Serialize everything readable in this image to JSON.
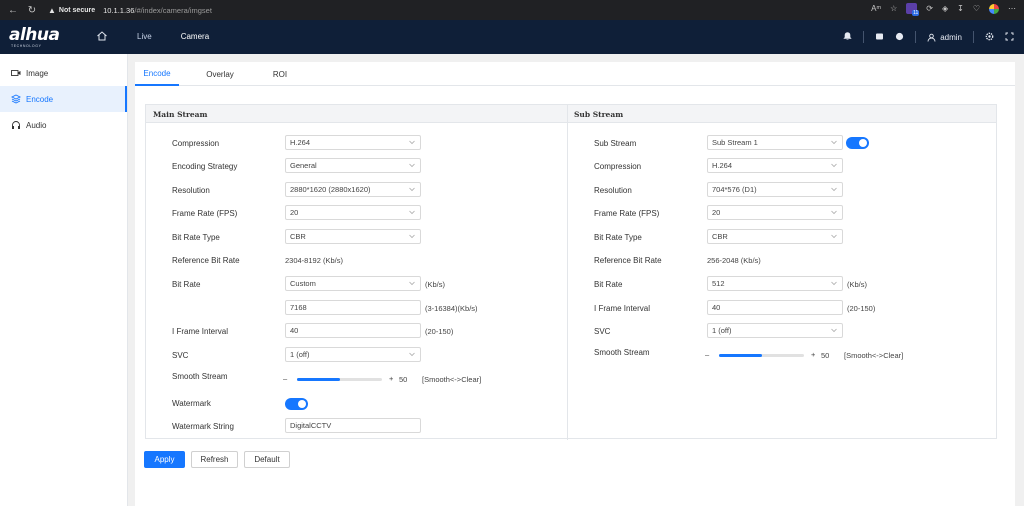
{
  "browser": {
    "not_secure": "Not secure",
    "url_host": "10.1.1.36",
    "url_path": "/#/index/camera/imgset",
    "ext_badge": "11"
  },
  "header": {
    "logo_text": "alhua",
    "logo_sub": "TECHNOLOGY",
    "nav": {
      "live": "Live",
      "camera": "Camera"
    },
    "user": "admin"
  },
  "sidebar": {
    "items": [
      {
        "label": "Image"
      },
      {
        "label": "Encode"
      },
      {
        "label": "Audio"
      }
    ]
  },
  "tabs": [
    "Encode",
    "Overlay",
    "ROI"
  ],
  "main_stream": {
    "title": "Main Stream",
    "compression_label": "Compression",
    "compression": "H.264",
    "encoding_label": "Encoding Strategy",
    "encoding": "General",
    "resolution_label": "Resolution",
    "resolution": "2880*1620 (2880x1620)",
    "fps_label": "Frame Rate (FPS)",
    "fps": "20",
    "brt_label": "Bit Rate Type",
    "brt": "CBR",
    "ref_label": "Reference Bit Rate",
    "ref": "2304-8192 (Kb/s)",
    "bitrate_label": "Bit Rate",
    "bitrate": "Custom",
    "bitrate_unit": "(Kb/s)",
    "custom_value": "7168",
    "custom_range": "(3-16384)(Kb/s)",
    "iframe_label": "I Frame Interval",
    "iframe": "40",
    "iframe_range": "(20-150)",
    "svc_label": "SVC",
    "svc": "1 (off)",
    "smooth_label": "Smooth Stream",
    "smooth_minus": "–",
    "smooth_plus": "+",
    "smooth_value": "50",
    "smooth_hint": "[Smooth<->Clear]",
    "smooth_level": 0.5,
    "watermark_label": "Watermark",
    "watermark_on": true,
    "watermark_string_label": "Watermark String",
    "watermark_string": "DigitalCCTV"
  },
  "sub_stream": {
    "title": "Sub Stream",
    "sub_label": "Sub Stream",
    "sub": "Sub Stream 1",
    "sub_on": true,
    "compression_label": "Compression",
    "compression": "H.264",
    "resolution_label": "Resolution",
    "resolution": "704*576 (D1)",
    "fps_label": "Frame Rate (FPS)",
    "fps": "20",
    "brt_label": "Bit Rate Type",
    "brt": "CBR",
    "ref_label": "Reference Bit Rate",
    "ref": "256-2048 (Kb/s)",
    "bitrate_label": "Bit Rate",
    "bitrate": "512",
    "bitrate_unit": "(Kb/s)",
    "iframe_label": "I Frame Interval",
    "iframe": "40",
    "iframe_range": "(20-150)",
    "svc_label": "SVC",
    "svc": "1 (off)",
    "smooth_label": "Smooth Stream",
    "smooth_minus": "–",
    "smooth_plus": "+",
    "smooth_value": "50",
    "smooth_hint": "[Smooth<->Clear]",
    "smooth_level": 0.5
  },
  "buttons": {
    "apply": "Apply",
    "refresh": "Refresh",
    "default": "Default"
  },
  "colors": {
    "accent": "#1677ff",
    "header_bg": "#0f1f38"
  }
}
